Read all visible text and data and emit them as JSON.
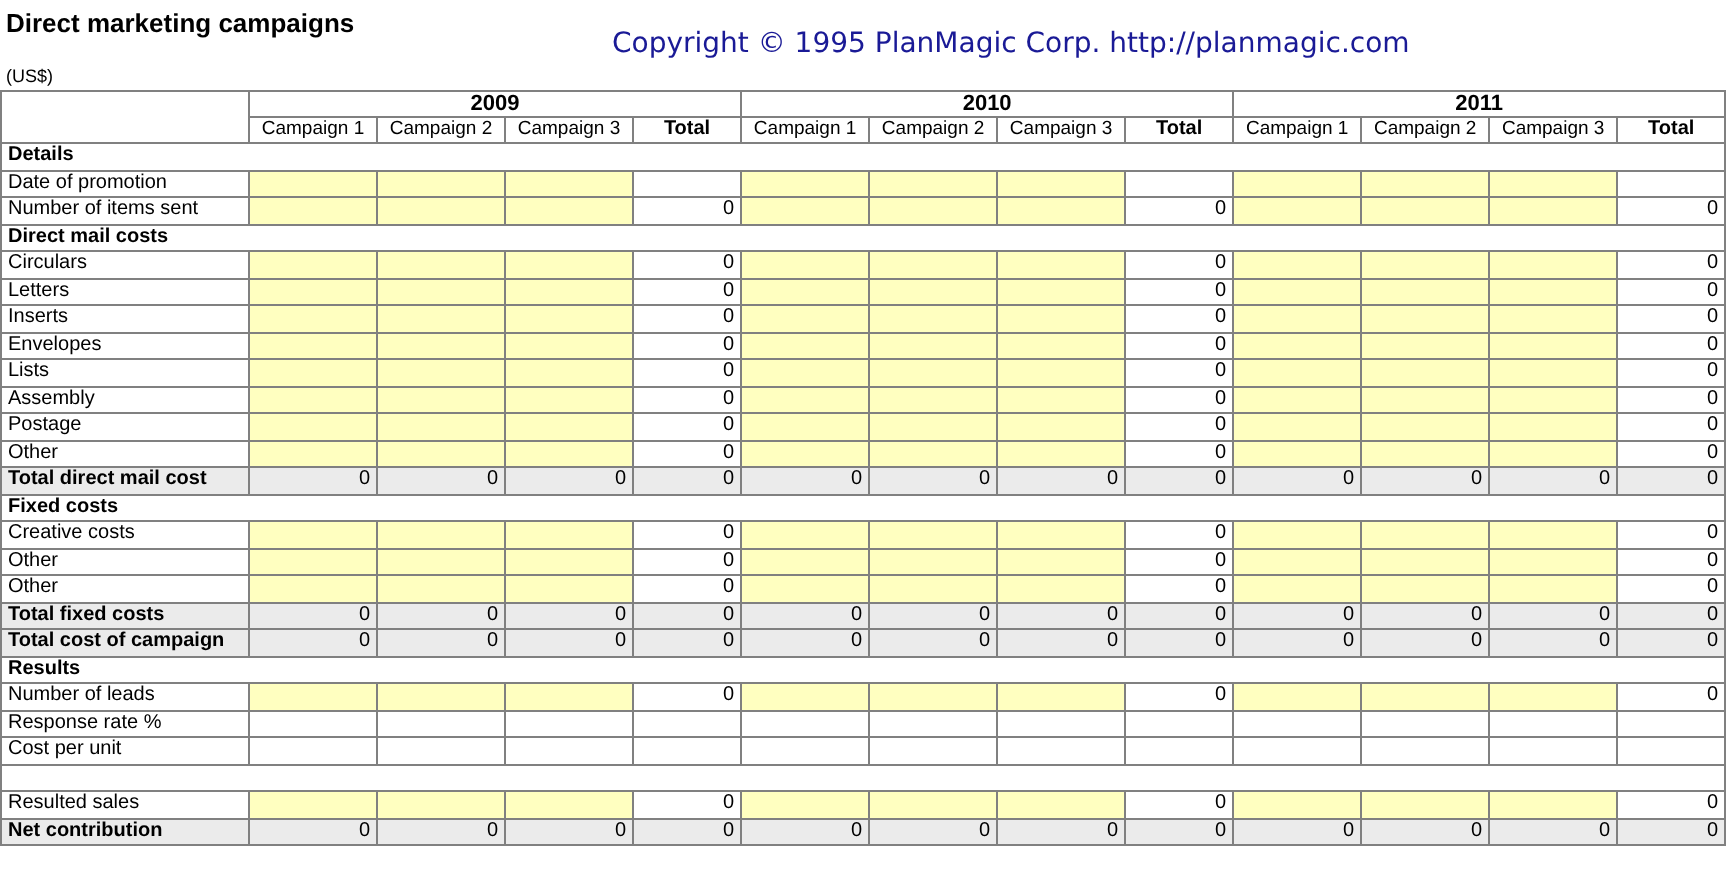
{
  "title": "Direct marketing campaigns",
  "copyright": "Copyright © 1995 PlanMagic Corp. http://planmagic.com",
  "currency_note": "(US$)",
  "years": [
    {
      "label": "2009",
      "columns": [
        "Campaign 1",
        "Campaign 2",
        "Campaign 3",
        "Total"
      ]
    },
    {
      "label": "2010",
      "columns": [
        "Campaign 1",
        "Campaign 2",
        "Campaign 3",
        "Total"
      ]
    },
    {
      "label": "2011",
      "columns": [
        "Campaign 1",
        "Campaign 2",
        "Campaign 3",
        "Total"
      ]
    }
  ],
  "rows": [
    {
      "kind": "section",
      "label": "Details"
    },
    {
      "kind": "input",
      "label": "Date of promotion"
    },
    {
      "kind": "input",
      "label": "Number of items sent",
      "totals": [
        "0",
        "0",
        "0"
      ]
    },
    {
      "kind": "section",
      "label": "Direct mail costs"
    },
    {
      "kind": "input",
      "label": "Circulars",
      "totals": [
        "0",
        "0",
        "0"
      ]
    },
    {
      "kind": "input",
      "label": "Letters",
      "totals": [
        "0",
        "0",
        "0"
      ]
    },
    {
      "kind": "input",
      "label": "Inserts",
      "totals": [
        "0",
        "0",
        "0"
      ]
    },
    {
      "kind": "input",
      "label": "Envelopes",
      "totals": [
        "0",
        "0",
        "0"
      ]
    },
    {
      "kind": "input",
      "label": "Lists",
      "totals": [
        "0",
        "0",
        "0"
      ]
    },
    {
      "kind": "input",
      "label": "Assembly",
      "totals": [
        "0",
        "0",
        "0"
      ]
    },
    {
      "kind": "input",
      "label": "Postage",
      "totals": [
        "0",
        "0",
        "0"
      ]
    },
    {
      "kind": "input",
      "label": "Other",
      "totals": [
        "0",
        "0",
        "0"
      ]
    },
    {
      "kind": "total",
      "label": "Total direct mail cost",
      "values": [
        "0",
        "0",
        "0",
        "0",
        "0",
        "0",
        "0",
        "0",
        "0",
        "0",
        "0",
        "0"
      ]
    },
    {
      "kind": "section",
      "label": "Fixed costs"
    },
    {
      "kind": "input",
      "label": "Creative costs",
      "totals": [
        "0",
        "0",
        "0"
      ]
    },
    {
      "kind": "input",
      "label": "Other",
      "totals": [
        "0",
        "0",
        "0"
      ]
    },
    {
      "kind": "input",
      "label": "Other",
      "totals": [
        "0",
        "0",
        "0"
      ]
    },
    {
      "kind": "total",
      "label": "Total fixed costs",
      "values": [
        "0",
        "0",
        "0",
        "0",
        "0",
        "0",
        "0",
        "0",
        "0",
        "0",
        "0",
        "0"
      ]
    },
    {
      "kind": "total",
      "label": "Total cost of campaign",
      "values": [
        "0",
        "0",
        "0",
        "0",
        "0",
        "0",
        "0",
        "0",
        "0",
        "0",
        "0",
        "0"
      ]
    },
    {
      "kind": "section",
      "label": "Results"
    },
    {
      "kind": "input",
      "label": "Number of leads",
      "totals": [
        "0",
        "0",
        "0"
      ]
    },
    {
      "kind": "calc",
      "label": "Response rate %"
    },
    {
      "kind": "calc",
      "label": "Cost per unit"
    },
    {
      "kind": "blank"
    },
    {
      "kind": "input",
      "label": "Resulted sales",
      "totals": [
        "0",
        "0",
        "0"
      ]
    },
    {
      "kind": "total",
      "label": "Net contribution",
      "values": [
        "0",
        "0",
        "0",
        "0",
        "0",
        "0",
        "0",
        "0",
        "0",
        "0",
        "0",
        "0"
      ]
    }
  ]
}
